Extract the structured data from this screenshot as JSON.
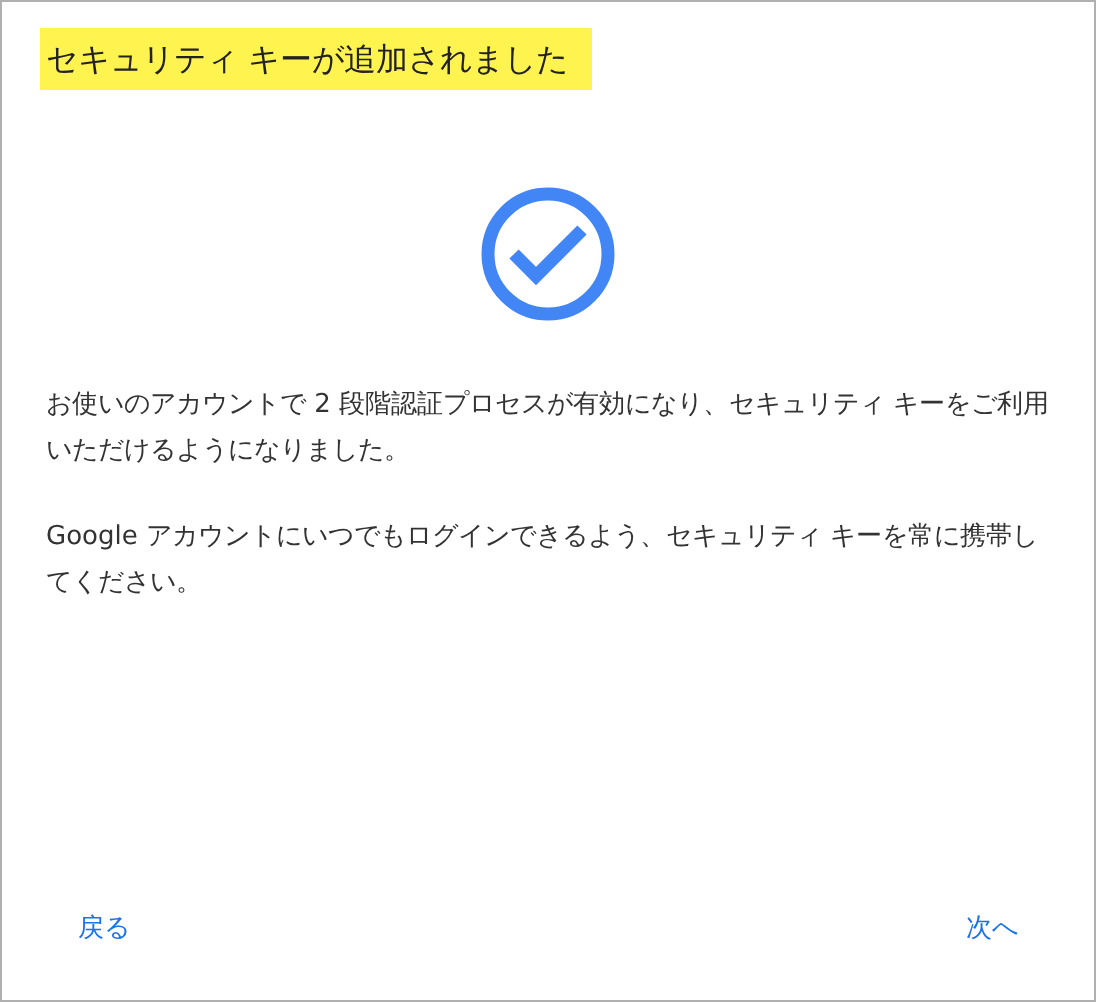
{
  "title": "セキュリティ キーが追加されました",
  "paragraphs": [
    "お使いのアカウントで 2 段階認証プロセスが有効になり、セキュリティ キーをご利用いただけるようになりました。",
    "Google アカウントにいつでもログインできるよう、セキュリティ キーを常に携帯してください。"
  ],
  "buttons": {
    "back": "戻る",
    "next": "次へ"
  }
}
